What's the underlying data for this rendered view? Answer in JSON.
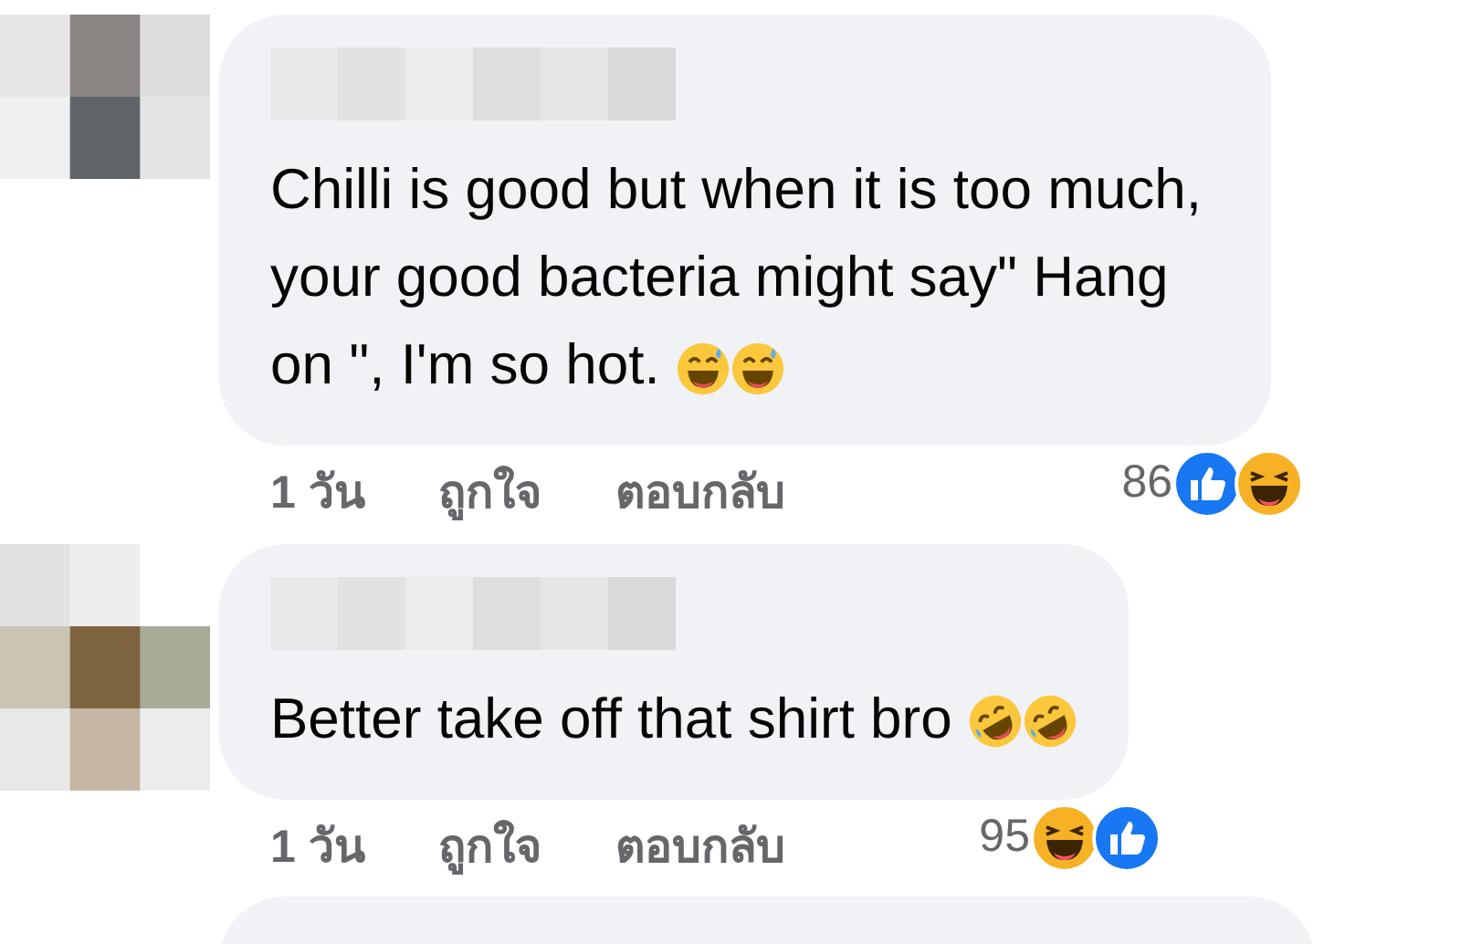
{
  "comments": [
    {
      "name": {
        "kind": "blurred"
      },
      "text": "Chilli is good but when it is too much, your good bacteria might say\" Hang on \", I'm so hot.",
      "emojis": [
        {
          "kind": "sweat-smile"
        },
        {
          "kind": "sweat-smile"
        }
      ],
      "time": "1 วัน",
      "like": "ถูกใจ",
      "reply": "ตอบกลับ",
      "reaction_count": "86",
      "reactions": [
        {
          "kind": "like"
        },
        {
          "kind": "haha"
        }
      ]
    },
    {
      "name": {
        "kind": "blurred"
      },
      "text": "Better take off that shirt bro",
      "emojis": [
        {
          "kind": "rofl"
        },
        {
          "kind": "rofl"
        }
      ],
      "time": "1 วัน",
      "like": "ถูกใจ",
      "reply": "ตอบกลับ",
      "reaction_count": "95",
      "reactions": [
        {
          "kind": "haha"
        },
        {
          "kind": "like"
        }
      ]
    }
  ]
}
